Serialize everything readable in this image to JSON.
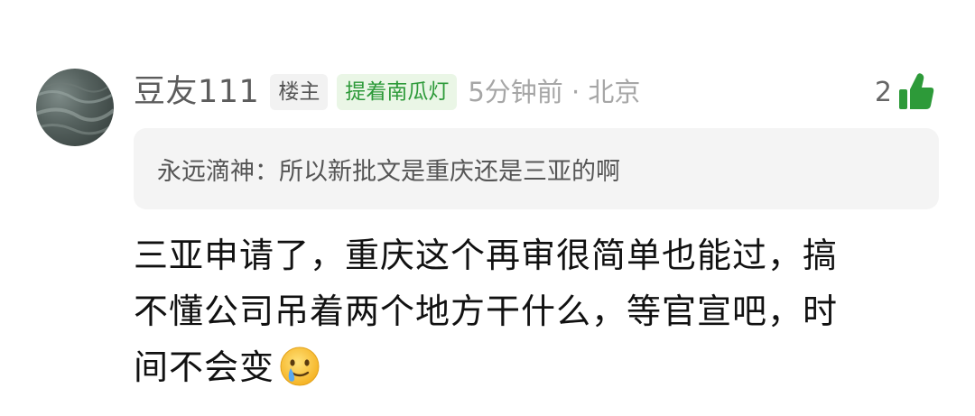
{
  "comment": {
    "author": {
      "name": "豆友111",
      "op_badge": "楼主",
      "tag_badge": "提着南瓜灯"
    },
    "meta": "5分钟前 · 北京",
    "like_count": "2",
    "quote": {
      "author": "永远滴神：",
      "text": "所以新批文是重庆还是三亚的啊"
    },
    "body": {
      "line1": "三亚申请了，重庆这个再审很简单也能过，搞",
      "line2": "不懂公司吊着两个地方干什么，等官宣吧，时",
      "line3": "间不会变"
    },
    "icons": {
      "avatar": "avatar-image",
      "like": "thumbs-up-icon",
      "emoji": "tearful-smile-emoji-icon"
    },
    "colors": {
      "accent_green": "#2d9a39",
      "badge_green_bg": "#eaf6e6",
      "meta_gray": "#a6a6a6"
    }
  }
}
